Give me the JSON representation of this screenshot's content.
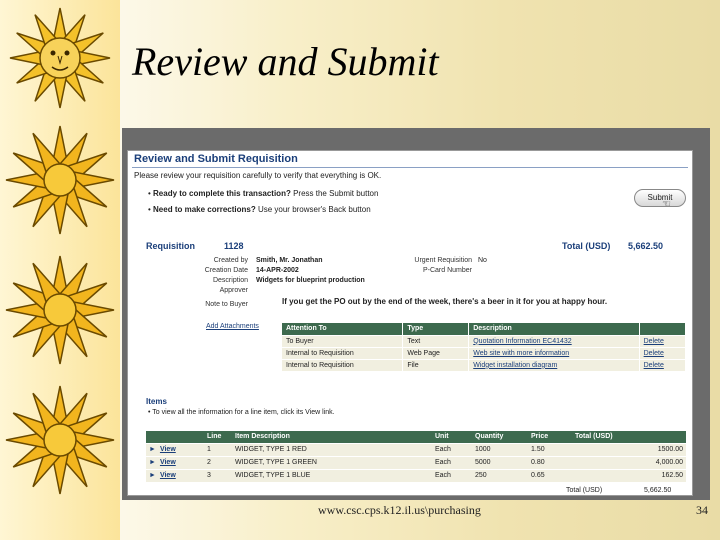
{
  "slide": {
    "title": "Review and Submit",
    "footer_url": "www.csc.cps.k12.il.us\\purchasing",
    "page_number": "34"
  },
  "screen": {
    "title": "Review and Submit Requisition",
    "instruction": "Please review your requisition carefully to verify that everything is OK.",
    "bullet1_bold": "Ready to complete this transaction?",
    "bullet1_rest": " Press the Submit button",
    "bullet2_bold": "Need to make corrections?",
    "bullet2_rest": " Use your browser's Back button",
    "submit_label": "Submit",
    "requisition_label": "Requisition",
    "requisition_number": "1128",
    "total_label": "Total (USD)",
    "total_value": "5,662.50",
    "fields": {
      "created_by_label": "Created by",
      "created_by": "Smith, Mr. Jonathan",
      "creation_date_label": "Creation Date",
      "creation_date": "14-APR-2002",
      "description_label": "Description",
      "description": "Widgets for blueprint production",
      "approver_label": "Approver",
      "approver": "",
      "note_to_buyer_label": "Note to Buyer",
      "note_to_buyer": "If you get the PO out by the end of the week, there's a beer in it for you at happy hour.",
      "urgent_label": "Urgent Requisition",
      "urgent_value": "No",
      "pcard_label": "P-Card Number",
      "pcard_value": ""
    },
    "attachments": {
      "link_label": "Add Attachments",
      "headers": [
        "Attention To",
        "Type",
        "Description",
        ""
      ],
      "rows": [
        [
          "To Buyer",
          "Text",
          "Quotation Information EC41432",
          "Delete"
        ],
        [
          "Internal to Requisition",
          "Web Page",
          "Web site with more information",
          "Delete"
        ],
        [
          "Internal to Requisition",
          "File",
          "Widget installation diagram",
          "Delete"
        ]
      ]
    },
    "items": {
      "label": "Items",
      "instruction": "To view all the information for a line item, click its View link.",
      "headers": [
        "",
        "Line",
        "Item Description",
        "Unit",
        "Quantity",
        "Price",
        "Total (USD)"
      ],
      "rows": [
        [
          "View",
          "1",
          "WIDGET, TYPE 1 RED",
          "Each",
          "1000",
          "1.50",
          "1500.00"
        ],
        [
          "View",
          "2",
          "WIDGET, TYPE 1 GREEN",
          "Each",
          "5000",
          "0.80",
          "4,000.00"
        ],
        [
          "View",
          "3",
          "WIDGET, TYPE 1 BLUE",
          "Each",
          "250",
          "0.65",
          "162.50"
        ]
      ],
      "total_label": "Total (USD)",
      "total_value": "5,662.50"
    }
  },
  "colors": {
    "header_blue": "#1b3f7a",
    "table_header_green": "#3d6a4e",
    "row_background": "#f1efe0"
  }
}
